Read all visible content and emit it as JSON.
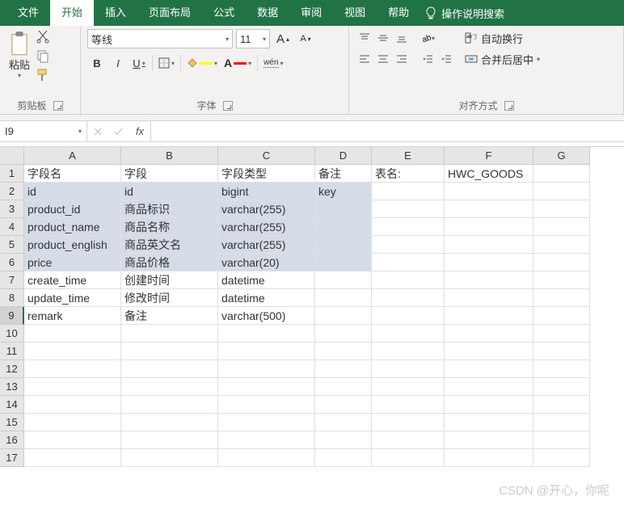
{
  "tabs": {
    "file": "文件",
    "home": "开始",
    "insert": "插入",
    "pagelayout": "页面布局",
    "formulas": "公式",
    "data": "数据",
    "review": "审阅",
    "view": "视图",
    "help": "帮助",
    "tellme": "操作说明搜索"
  },
  "ribbon": {
    "clipboard": {
      "paste": "粘贴",
      "label": "剪贴板"
    },
    "font": {
      "name": "等线",
      "size": "11",
      "bold": "B",
      "italic": "I",
      "underline": "U",
      "ruby": "wén",
      "label": "字体",
      "growA": "A",
      "shrinkA": "A"
    },
    "align": {
      "wrap": "自动换行",
      "merge": "合并后居中",
      "label": "对齐方式"
    }
  },
  "formulabar": {
    "namebox": "I9",
    "fx": "fx"
  },
  "columns": [
    "A",
    "B",
    "C",
    "D",
    "E",
    "F",
    "G"
  ],
  "rows": [
    {
      "n": "1",
      "a": "字段名",
      "b": "字段",
      "c": "字段类型",
      "d": "备注",
      "e": "表名:",
      "f": "HWC_GOODS",
      "g": "",
      "hl": false
    },
    {
      "n": "2",
      "a": "id",
      "b": "id",
      "c": "bigint",
      "d": "key",
      "e": "",
      "f": "",
      "g": "",
      "hl": true
    },
    {
      "n": "3",
      "a": "product_id",
      "b": "商品标识",
      "c": "varchar(255)",
      "d": "",
      "e": "",
      "f": "",
      "g": "",
      "hl": true
    },
    {
      "n": "4",
      "a": "product_name",
      "b": "商品名称",
      "c": "varchar(255)",
      "d": "",
      "e": "",
      "f": "",
      "g": "",
      "hl": true
    },
    {
      "n": "5",
      "a": "product_english",
      "b": "商品英文名",
      "c": "varchar(255)",
      "d": "",
      "e": "",
      "f": "",
      "g": "",
      "hl": true
    },
    {
      "n": "6",
      "a": "price",
      "b": "商品价格",
      "c": "varchar(20)",
      "d": "",
      "e": "",
      "f": "",
      "g": "",
      "hl": true
    },
    {
      "n": "7",
      "a": "create_time",
      "b": "创建时间",
      "c": "datetime",
      "d": "",
      "e": "",
      "f": "",
      "g": "",
      "hl": false
    },
    {
      "n": "8",
      "a": "update_time",
      "b": "修改时间",
      "c": "datetime",
      "d": "",
      "e": "",
      "f": "",
      "g": "",
      "hl": false
    },
    {
      "n": "9",
      "a": "remark",
      "b": "备注",
      "c": "varchar(500)",
      "d": "",
      "e": "",
      "f": "",
      "g": "",
      "hl": false,
      "sel": true
    },
    {
      "n": "10",
      "a": "",
      "b": "",
      "c": "",
      "d": "",
      "e": "",
      "f": "",
      "g": "",
      "hl": false
    },
    {
      "n": "11",
      "a": "",
      "b": "",
      "c": "",
      "d": "",
      "e": "",
      "f": "",
      "g": "",
      "hl": false
    },
    {
      "n": "12",
      "a": "",
      "b": "",
      "c": "",
      "d": "",
      "e": "",
      "f": "",
      "g": "",
      "hl": false
    },
    {
      "n": "13",
      "a": "",
      "b": "",
      "c": "",
      "d": "",
      "e": "",
      "f": "",
      "g": "",
      "hl": false
    },
    {
      "n": "14",
      "a": "",
      "b": "",
      "c": "",
      "d": "",
      "e": "",
      "f": "",
      "g": "",
      "hl": false
    },
    {
      "n": "15",
      "a": "",
      "b": "",
      "c": "",
      "d": "",
      "e": "",
      "f": "",
      "g": "",
      "hl": false
    },
    {
      "n": "16",
      "a": "",
      "b": "",
      "c": "",
      "d": "",
      "e": "",
      "f": "",
      "g": "",
      "hl": false
    },
    {
      "n": "17",
      "a": "",
      "b": "",
      "c": "",
      "d": "",
      "e": "",
      "f": "",
      "g": "",
      "hl": false
    }
  ],
  "watermark": "CSDN @开心，你呢"
}
